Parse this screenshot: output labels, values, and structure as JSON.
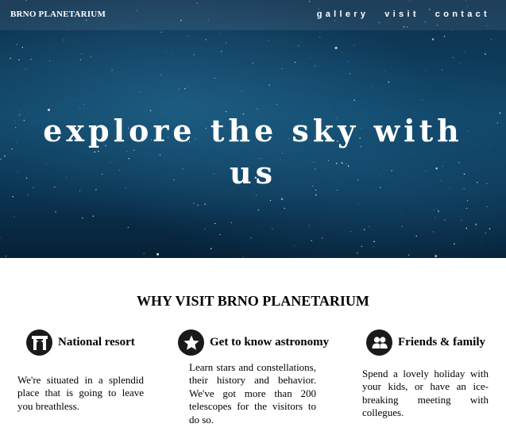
{
  "header": {
    "brand": "BRNO PLANETARIUM",
    "nav": [
      "gallery",
      "visit",
      "contact"
    ]
  },
  "hero": {
    "title": "explore the sky with us"
  },
  "why": {
    "title": "WHY VISIT BRNO PLANETARIUM",
    "features": [
      {
        "icon": "arch-icon",
        "title": "National resort",
        "text": "We're situated in a splendid place that is going to leave you breathless."
      },
      {
        "icon": "star-icon",
        "title": "Get to know astronomy",
        "text": "Learn stars and constellations, their history and behavior. We've got more than 200 telescopes for the visitors to do so."
      },
      {
        "icon": "people-icon",
        "title": "Friends & family",
        "text": "Spend a lovely holiday with your kids, or have an ice-breaking meeting with collegues."
      }
    ]
  },
  "colors": {
    "hero_dark": "#0b3352",
    "hero_light": "#1e6a8f",
    "icon_bg": "#1a1a1a",
    "text": "#000000"
  }
}
